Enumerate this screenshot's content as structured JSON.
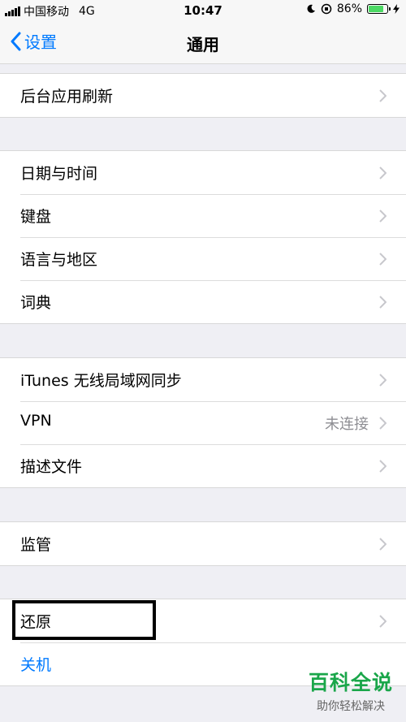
{
  "status_bar": {
    "carrier": "中国移动",
    "network": "4G",
    "time": "10:47",
    "battery": "86%",
    "battery_level": 0.86
  },
  "nav": {
    "back_label": "设置",
    "title": "通用"
  },
  "groups": [
    {
      "rows": [
        {
          "label": "后台应用刷新"
        }
      ]
    },
    {
      "rows": [
        {
          "label": "日期与时间"
        },
        {
          "label": "键盘"
        },
        {
          "label": "语言与地区"
        },
        {
          "label": "词典"
        }
      ]
    },
    {
      "rows": [
        {
          "label": "iTunes 无线局域网同步"
        },
        {
          "label": "VPN",
          "value": "未连接"
        },
        {
          "label": "描述文件"
        }
      ]
    },
    {
      "rows": [
        {
          "label": "监管"
        }
      ]
    },
    {
      "rows": [
        {
          "label": "还原"
        },
        {
          "label": "关机"
        }
      ]
    }
  ],
  "watermark": {
    "title": "百科全说",
    "subtitle": "助你轻松解决"
  },
  "colors": {
    "accent": "#007aff",
    "battery": "#4cd964",
    "background": "#efeff4",
    "watermark": "#1aa64a"
  }
}
